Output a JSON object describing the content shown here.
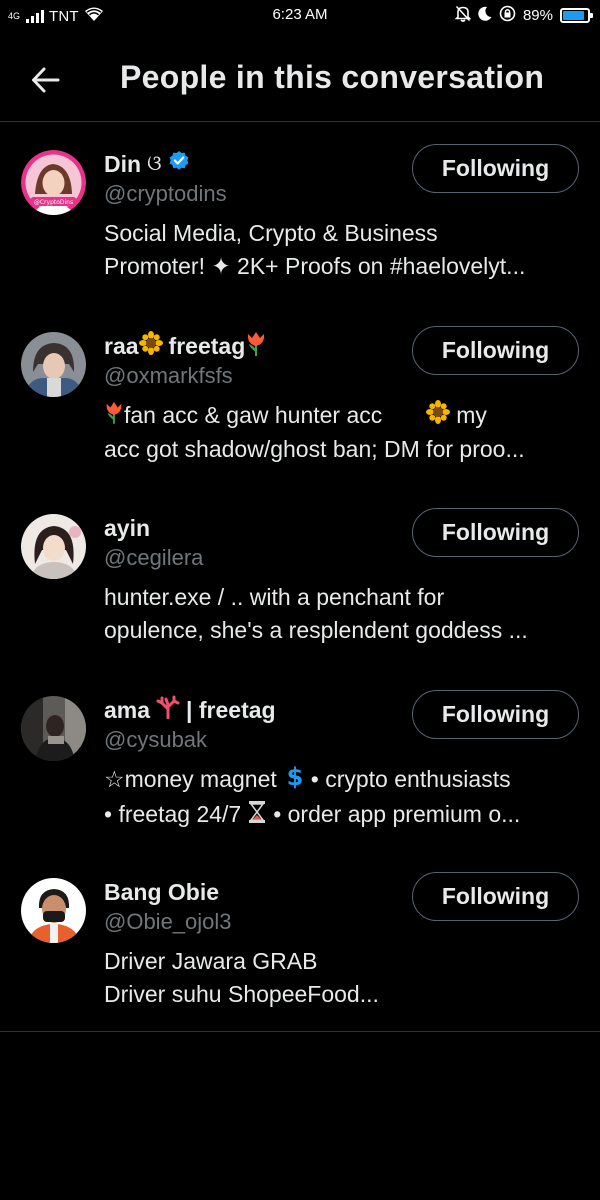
{
  "status_bar": {
    "network": "4G",
    "carrier": "TNT",
    "time": "6:23 AM",
    "battery": "89%",
    "battery_level": 0.89,
    "icons": [
      "signal-icon",
      "wifi-icon",
      "mute-icon",
      "moon-icon",
      "rotation-lock-icon",
      "battery-icon"
    ]
  },
  "header": {
    "back_icon": "arrow-left-icon",
    "title": "People in this conversation"
  },
  "people": [
    {
      "name": "Din",
      "name_suffix": "ଓ",
      "verified": true,
      "handle": "@cryptodins",
      "bio_line1": "Social Media, Crypto & Business",
      "bio_line2": "Promoter! ✦ 2K+ Proofs on #haelovelyt...",
      "button": "Following",
      "avatar_text": "@CryptoDins"
    },
    {
      "name": "raa",
      "name_part2": "freetag",
      "handle": "@oxmarkfsfs",
      "bio_line1": "fan acc & gaw hunter acc",
      "bio_line1_b": "my",
      "bio_line2": "acc got shadow/ghost ban; DM for proo...",
      "button": "Following"
    },
    {
      "name": "ayin",
      "handle": "@cegilera",
      "bio_line1": "hunter.exe / .. with a penchant for",
      "bio_line2": "opulence, she's a resplendent goddess ...",
      "button": "Following"
    },
    {
      "name": "ama",
      "name_part2": "| freetag",
      "handle": "@cysubak",
      "bio_line1": "☆money magnet",
      "bio_line1_b": "• crypto enthusiasts",
      "bio_line2": "• freetag 24/7",
      "bio_line2_b": "• order app premium o...",
      "button": "Following"
    },
    {
      "name": "Bang Obie",
      "handle": "@Obie_ojol3",
      "bio_line1": "Driver Jawara GRAB",
      "bio_line2": "Driver suhu ShopeeFood...",
      "button": "Following"
    }
  ],
  "colors": {
    "background": "#000000",
    "text_primary": "#e7e9ea",
    "text_secondary": "#71767b",
    "divider": "#2f3336",
    "verified_blue": "#1d9bf0",
    "button_border": "#536471"
  }
}
